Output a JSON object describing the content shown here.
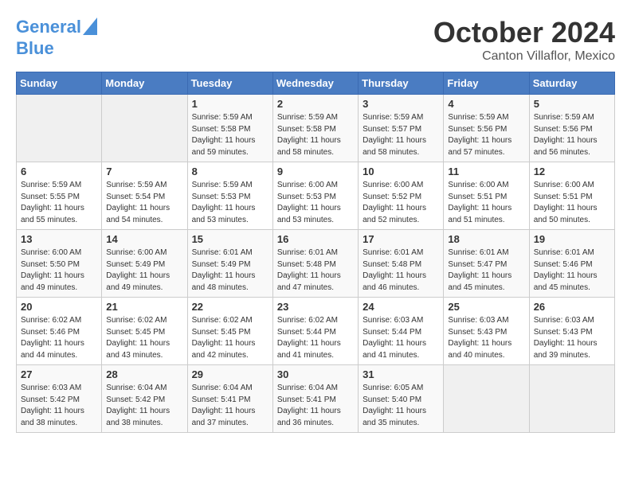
{
  "header": {
    "logo_line1": "General",
    "logo_line2": "Blue",
    "title": "October 2024",
    "subtitle": "Canton Villaflor, Mexico"
  },
  "weekdays": [
    "Sunday",
    "Monday",
    "Tuesday",
    "Wednesday",
    "Thursday",
    "Friday",
    "Saturday"
  ],
  "weeks": [
    [
      {
        "day": "",
        "info": ""
      },
      {
        "day": "",
        "info": ""
      },
      {
        "day": "1",
        "info": "Sunrise: 5:59 AM\nSunset: 5:58 PM\nDaylight: 11 hours and 59 minutes."
      },
      {
        "day": "2",
        "info": "Sunrise: 5:59 AM\nSunset: 5:58 PM\nDaylight: 11 hours and 58 minutes."
      },
      {
        "day": "3",
        "info": "Sunrise: 5:59 AM\nSunset: 5:57 PM\nDaylight: 11 hours and 58 minutes."
      },
      {
        "day": "4",
        "info": "Sunrise: 5:59 AM\nSunset: 5:56 PM\nDaylight: 11 hours and 57 minutes."
      },
      {
        "day": "5",
        "info": "Sunrise: 5:59 AM\nSunset: 5:56 PM\nDaylight: 11 hours and 56 minutes."
      }
    ],
    [
      {
        "day": "6",
        "info": "Sunrise: 5:59 AM\nSunset: 5:55 PM\nDaylight: 11 hours and 55 minutes."
      },
      {
        "day": "7",
        "info": "Sunrise: 5:59 AM\nSunset: 5:54 PM\nDaylight: 11 hours and 54 minutes."
      },
      {
        "day": "8",
        "info": "Sunrise: 5:59 AM\nSunset: 5:53 PM\nDaylight: 11 hours and 53 minutes."
      },
      {
        "day": "9",
        "info": "Sunrise: 6:00 AM\nSunset: 5:53 PM\nDaylight: 11 hours and 53 minutes."
      },
      {
        "day": "10",
        "info": "Sunrise: 6:00 AM\nSunset: 5:52 PM\nDaylight: 11 hours and 52 minutes."
      },
      {
        "day": "11",
        "info": "Sunrise: 6:00 AM\nSunset: 5:51 PM\nDaylight: 11 hours and 51 minutes."
      },
      {
        "day": "12",
        "info": "Sunrise: 6:00 AM\nSunset: 5:51 PM\nDaylight: 11 hours and 50 minutes."
      }
    ],
    [
      {
        "day": "13",
        "info": "Sunrise: 6:00 AM\nSunset: 5:50 PM\nDaylight: 11 hours and 49 minutes."
      },
      {
        "day": "14",
        "info": "Sunrise: 6:00 AM\nSunset: 5:49 PM\nDaylight: 11 hours and 49 minutes."
      },
      {
        "day": "15",
        "info": "Sunrise: 6:01 AM\nSunset: 5:49 PM\nDaylight: 11 hours and 48 minutes."
      },
      {
        "day": "16",
        "info": "Sunrise: 6:01 AM\nSunset: 5:48 PM\nDaylight: 11 hours and 47 minutes."
      },
      {
        "day": "17",
        "info": "Sunrise: 6:01 AM\nSunset: 5:48 PM\nDaylight: 11 hours and 46 minutes."
      },
      {
        "day": "18",
        "info": "Sunrise: 6:01 AM\nSunset: 5:47 PM\nDaylight: 11 hours and 45 minutes."
      },
      {
        "day": "19",
        "info": "Sunrise: 6:01 AM\nSunset: 5:46 PM\nDaylight: 11 hours and 45 minutes."
      }
    ],
    [
      {
        "day": "20",
        "info": "Sunrise: 6:02 AM\nSunset: 5:46 PM\nDaylight: 11 hours and 44 minutes."
      },
      {
        "day": "21",
        "info": "Sunrise: 6:02 AM\nSunset: 5:45 PM\nDaylight: 11 hours and 43 minutes."
      },
      {
        "day": "22",
        "info": "Sunrise: 6:02 AM\nSunset: 5:45 PM\nDaylight: 11 hours and 42 minutes."
      },
      {
        "day": "23",
        "info": "Sunrise: 6:02 AM\nSunset: 5:44 PM\nDaylight: 11 hours and 41 minutes."
      },
      {
        "day": "24",
        "info": "Sunrise: 6:03 AM\nSunset: 5:44 PM\nDaylight: 11 hours and 41 minutes."
      },
      {
        "day": "25",
        "info": "Sunrise: 6:03 AM\nSunset: 5:43 PM\nDaylight: 11 hours and 40 minutes."
      },
      {
        "day": "26",
        "info": "Sunrise: 6:03 AM\nSunset: 5:43 PM\nDaylight: 11 hours and 39 minutes."
      }
    ],
    [
      {
        "day": "27",
        "info": "Sunrise: 6:03 AM\nSunset: 5:42 PM\nDaylight: 11 hours and 38 minutes."
      },
      {
        "day": "28",
        "info": "Sunrise: 6:04 AM\nSunset: 5:42 PM\nDaylight: 11 hours and 38 minutes."
      },
      {
        "day": "29",
        "info": "Sunrise: 6:04 AM\nSunset: 5:41 PM\nDaylight: 11 hours and 37 minutes."
      },
      {
        "day": "30",
        "info": "Sunrise: 6:04 AM\nSunset: 5:41 PM\nDaylight: 11 hours and 36 minutes."
      },
      {
        "day": "31",
        "info": "Sunrise: 6:05 AM\nSunset: 5:40 PM\nDaylight: 11 hours and 35 minutes."
      },
      {
        "day": "",
        "info": ""
      },
      {
        "day": "",
        "info": ""
      }
    ]
  ]
}
